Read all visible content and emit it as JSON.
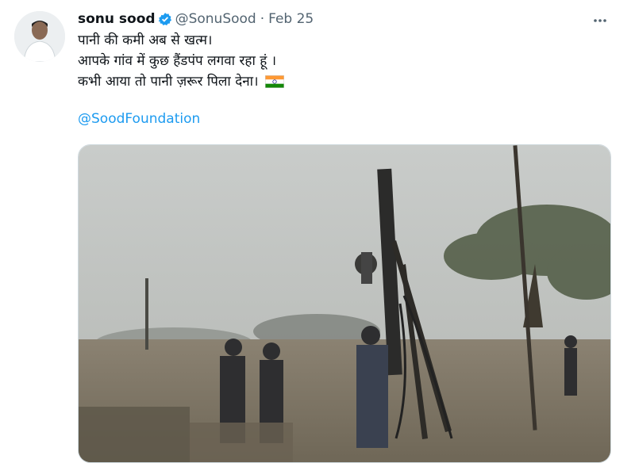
{
  "tweet": {
    "display_name": "sonu sood",
    "handle": "@SonuSood",
    "separator": "·",
    "date": "Feb 25",
    "lines": [
      "पानी की कमी अब से खत्म।",
      "आपके गांव में कुछ हैंडपंप लगवा रहा हूं ।",
      "कभी आया तो पानी ज़रूर पिला देना।"
    ],
    "mention": "@SoodFoundation",
    "icons": {
      "verified": "verified-badge-icon",
      "more": "more-dots-icon",
      "flag": "india-flag-icon"
    }
  },
  "colors": {
    "verified": "#1d9bf0",
    "link": "#1d9bf0",
    "secondary_text": "#536471"
  }
}
